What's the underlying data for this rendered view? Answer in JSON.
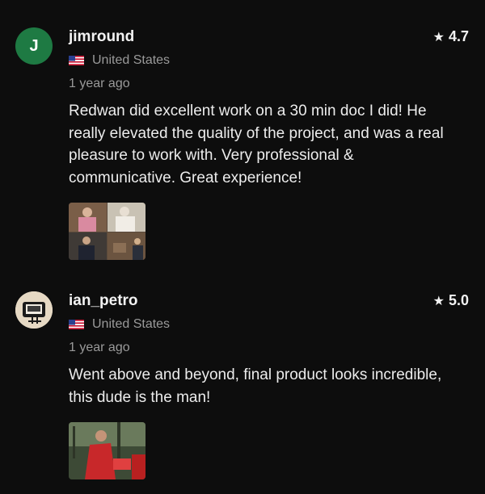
{
  "reviews": [
    {
      "avatar_letter": "J",
      "avatar_color": "#1e7a43",
      "username": "jimround",
      "rating": "4.7",
      "star_icon": "star-icon",
      "country": "United States",
      "flag_icon": "us-flag-icon",
      "time": "1 year ago",
      "text": "Redwan did excellent work on a 30 min doc I did! He really elevated the quality of the project, and was a real pleasure to work with.  Very professional & communicative. Great experience!"
    },
    {
      "username": "ian_petro",
      "rating": "5.0",
      "star_icon": "star-icon",
      "country": "United States",
      "flag_icon": "us-flag-icon",
      "time": "1 year ago",
      "text": "Went above and beyond, final product looks incredible, this dude is the man!"
    }
  ]
}
